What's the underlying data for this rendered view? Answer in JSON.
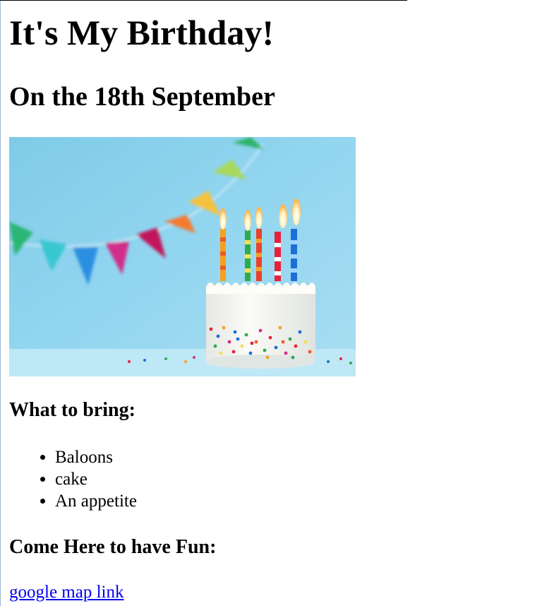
{
  "page": {
    "title": "It's My Birthday!",
    "subtitle": "On the 18th September"
  },
  "photo": {
    "subject": "birthday-cake-with-candles-and-bunting",
    "colors": {
      "background": "#8fd3ee",
      "cake": "#f7f7f2"
    }
  },
  "bring": {
    "heading": "What to bring:",
    "items": [
      "Baloons",
      "cake",
      "An appetite"
    ]
  },
  "fun": {
    "heading": "Come Here to have Fun:",
    "link_label": "google map link"
  }
}
